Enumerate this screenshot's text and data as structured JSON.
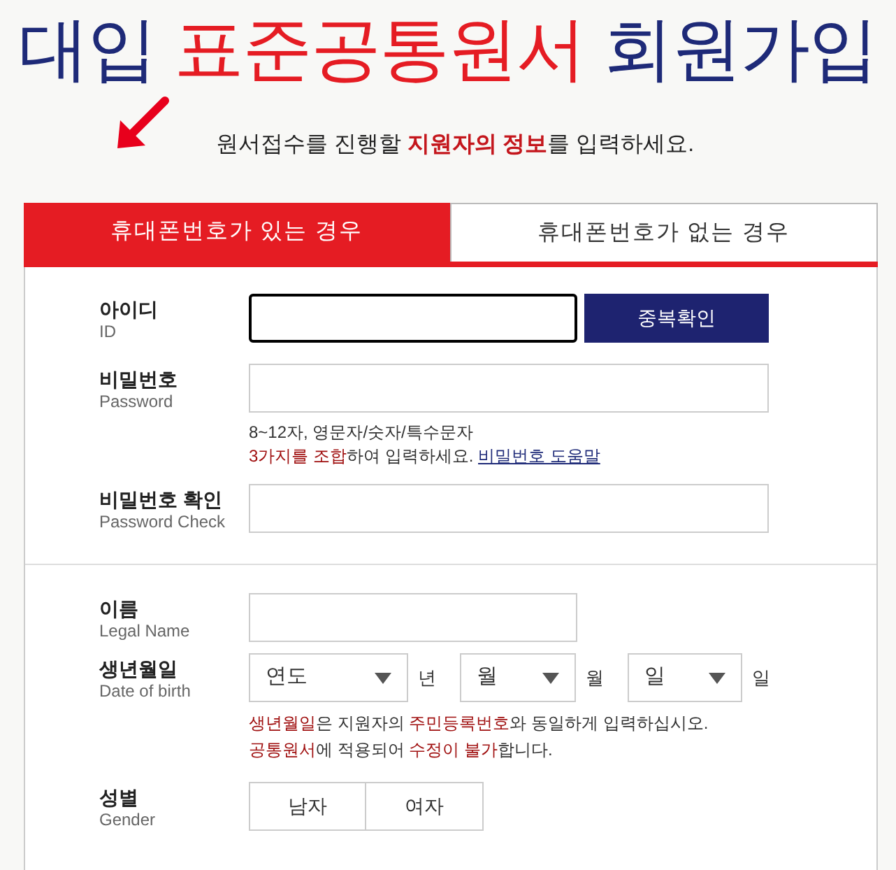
{
  "title": [
    {
      "text": "대입 ",
      "highlight": false
    },
    {
      "text": "표준공통원서",
      "highlight": true
    },
    {
      "text": " 회원가입",
      "highlight": false
    }
  ],
  "subtitle": [
    {
      "text": "원서접수를 진행할 ",
      "highlight": false
    },
    {
      "text": "지원자의 정보",
      "highlight": true
    },
    {
      "text": "를 입력하세요.",
      "highlight": false
    }
  ],
  "tabs": [
    {
      "label": "휴대폰번호가 있는 경우",
      "selected": true
    },
    {
      "label": "휴대폰번호가 없는 경우",
      "selected": false
    }
  ],
  "id_row": {
    "label": "아이디",
    "sublabel": "ID",
    "focused": true,
    "button": "중복확인"
  },
  "password_row": {
    "label": "비밀번호",
    "sublabel": "Password",
    "hint": "8~12자, 영문자/숫자/특수문자",
    "note": [
      {
        "text": "3가지를 조합",
        "highlight": true
      },
      {
        "text": "하여 입력하세요. ",
        "highlight": false
      }
    ],
    "help_link": "비밀번호 도움말"
  },
  "password_check_row": {
    "label": "비밀번호 확인",
    "sublabel": "Password Check"
  },
  "name_row": {
    "label": "이름",
    "sublabel": "Legal Name"
  },
  "birth_row": {
    "label": "생년월일",
    "sublabel": "Date of birth",
    "selects": [
      {
        "value": "연도",
        "unit": "년"
      },
      {
        "value": "월",
        "unit": "월"
      },
      {
        "value": "일",
        "unit": "일"
      }
    ],
    "notes": [
      [
        {
          "text": "생년월일",
          "highlight": true
        },
        {
          "text": "은 지원자의 ",
          "highlight": false
        },
        {
          "text": "주민등록번호",
          "highlight": true
        },
        {
          "text": "와 동일하게 입력하십시오.",
          "highlight": false
        }
      ],
      [
        {
          "text": "공통원서",
          "highlight": true
        },
        {
          "text": "에 적용되어 ",
          "highlight": false
        },
        {
          "text": "수정이 불가",
          "highlight": true
        },
        {
          "text": "합니다.",
          "highlight": false
        }
      ]
    ]
  },
  "gender_row": {
    "label": "성별",
    "sublabel": "Gender",
    "options": [
      {
        "label": "남자",
        "selected": false
      },
      {
        "label": "여자",
        "selected": false
      }
    ]
  }
}
